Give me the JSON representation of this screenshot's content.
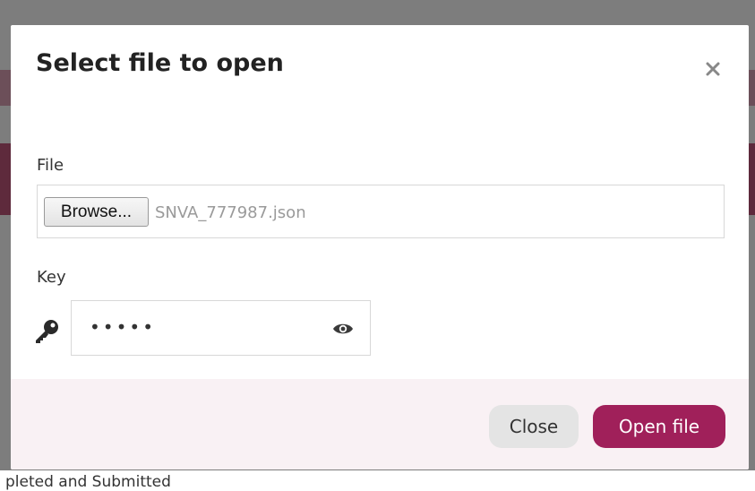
{
  "dialog": {
    "title": "Select file to open",
    "close_icon": "close-icon"
  },
  "file_field": {
    "label": "File",
    "browse_label": "Browse...",
    "selected_file": "SNVA_777987.json"
  },
  "key_field": {
    "label": "Key",
    "icon": "key-icon",
    "masked_value": "•••••",
    "toggle_icon": "eye-icon"
  },
  "footer": {
    "close_label": "Close",
    "open_label": "Open file"
  },
  "background": {
    "partial_text": "pleted and Submitted"
  },
  "colors": {
    "primary": "#a0205a",
    "footer_bg": "#f9f1f4",
    "backdrop": "#7d7d7d"
  }
}
